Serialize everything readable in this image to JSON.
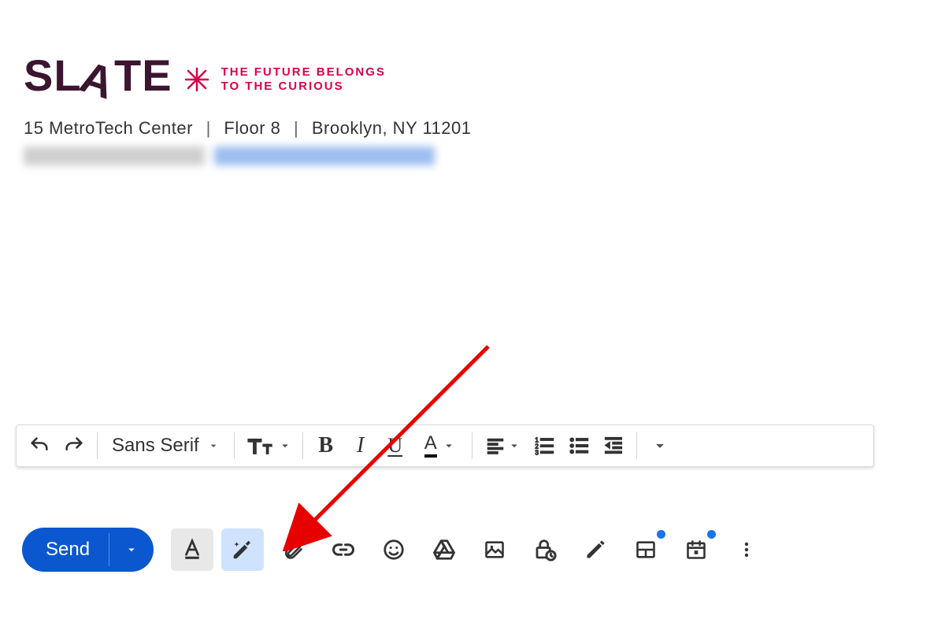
{
  "signature": {
    "brand": "SLATE",
    "tagline_line1": "THE FUTURE BELONGS",
    "tagline_line2": "TO THE CURIOUS",
    "address_1": "15 MetroTech Center",
    "address_2": "Floor 8",
    "address_3": "Brooklyn, NY 11201"
  },
  "formatting": {
    "font_family": "Sans Serif"
  },
  "toolbar": {
    "send_label": "Send"
  },
  "icons": {
    "undo": "undo-icon",
    "redo": "redo-icon",
    "font_size": "font-size-icon",
    "bold": "B",
    "italic": "I",
    "underline": "U",
    "text_color": "A",
    "align": "align-icon",
    "numbered_list": "numbered-list-icon",
    "bulleted_list": "bulleted-list-icon",
    "indent_decrease": "indent-decrease-icon",
    "more_format": "more-format-icon",
    "format_options": "format-options-icon",
    "help_write": "help-write-icon",
    "attach": "attach-icon",
    "link": "link-icon",
    "emoji": "emoji-icon",
    "drive": "drive-icon",
    "image": "image-icon",
    "confidential": "confidential-icon",
    "signature": "signature-pen-icon",
    "layout": "layout-icon",
    "schedule": "schedule-icon",
    "more": "more-icon"
  },
  "colors": {
    "brand_dark": "#3c1530",
    "brand_pink": "#d8024a",
    "primary": "#0b57d0",
    "highlight": "#cfe3ff",
    "annotation": "#e60000"
  }
}
